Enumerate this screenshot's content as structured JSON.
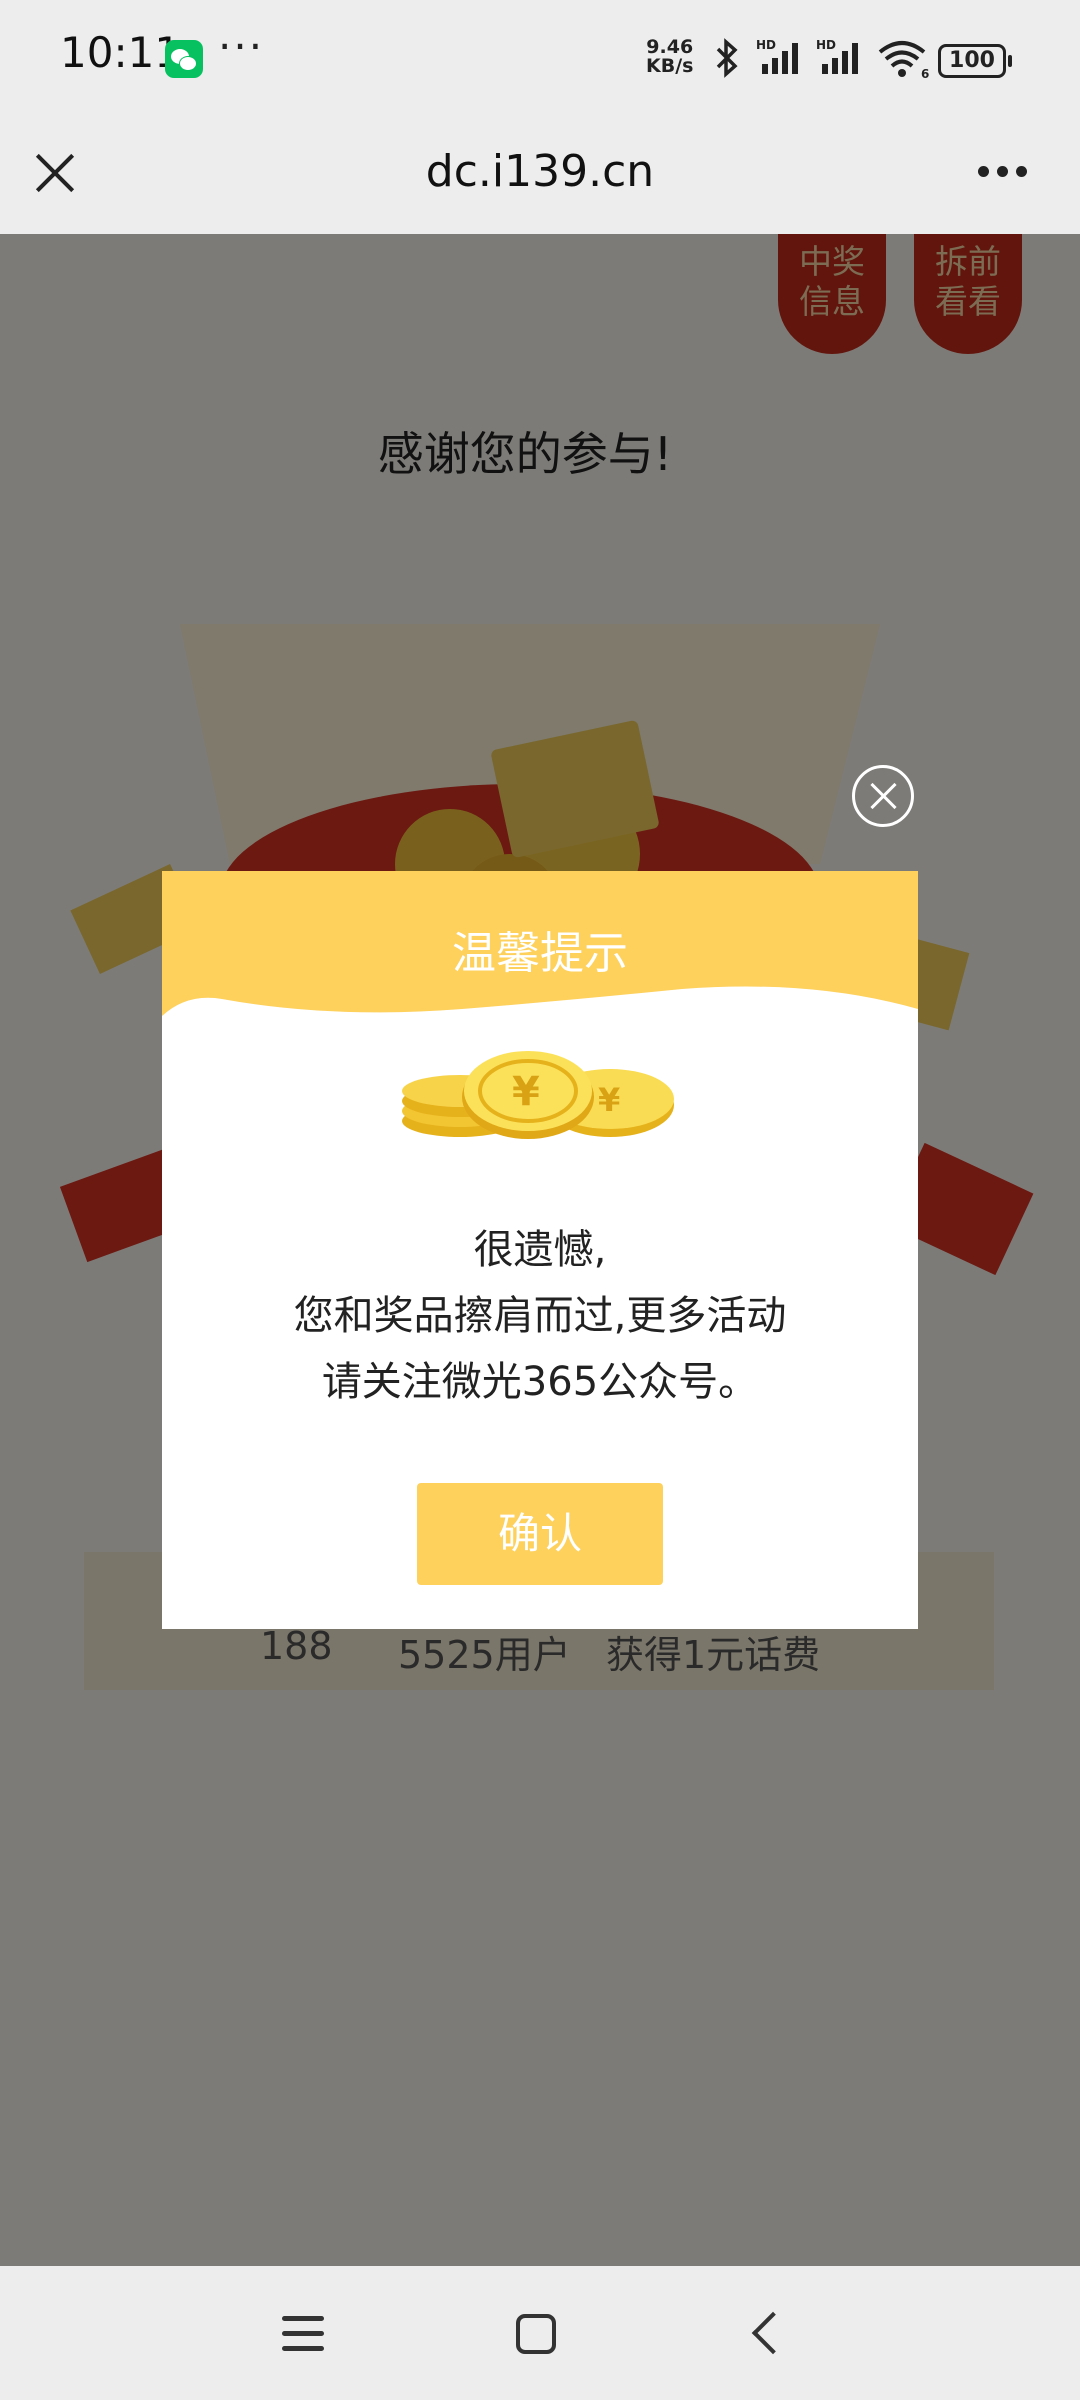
{
  "status": {
    "time": "10:11",
    "more": "···",
    "speed_value": "9.46",
    "speed_unit": "KB/s",
    "signal_label": "HD",
    "wifi_label": "6",
    "battery": "100"
  },
  "navbar": {
    "url": "dc.i139.cn"
  },
  "page": {
    "tag_prize": [
      "中奖",
      "信息"
    ],
    "tag_preview": [
      "拆前",
      "看看"
    ],
    "thanks": "感谢您的参与!",
    "ticker": [
      "188",
      "5525用户",
      "获得1元话费"
    ]
  },
  "modal": {
    "title": "温馨提示",
    "message": [
      "很遗憾,",
      "您和奖品擦肩而过,更多活动",
      "请关注微光365公众号。"
    ],
    "confirm": "确认"
  },
  "colors": {
    "header_yellow": "#fed05c",
    "tag_red": "#c52b1b",
    "bar_gray": "#ededed"
  },
  "icons": [
    "close-icon",
    "more-icon",
    "close-circle-icon",
    "coins-icon",
    "menu-icon",
    "home-icon",
    "back-icon"
  ]
}
